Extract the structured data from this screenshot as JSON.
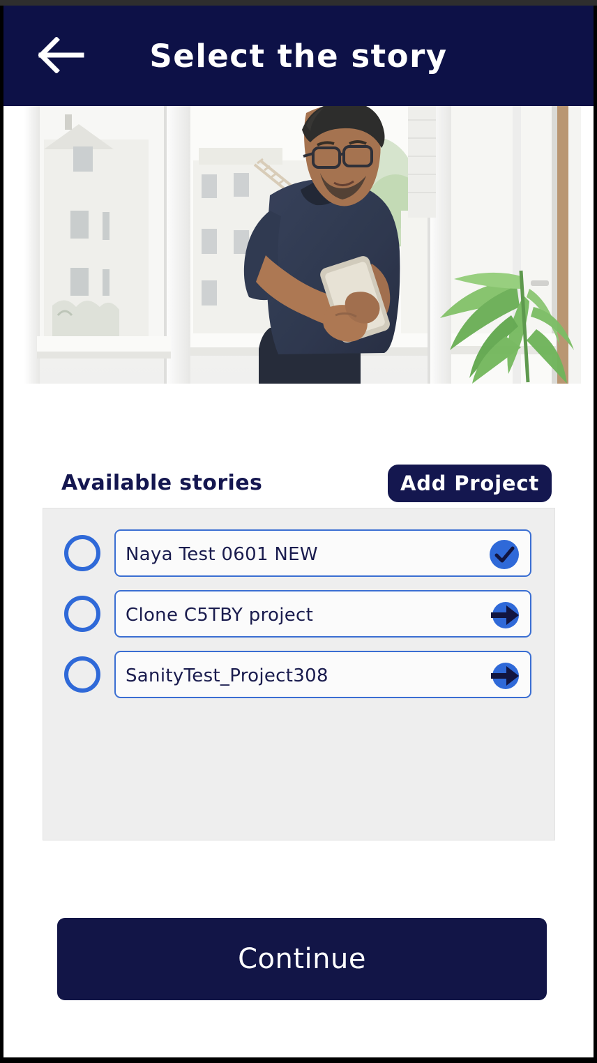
{
  "appbar": {
    "title": "Select the story",
    "back_icon": "arrow-left-icon",
    "background_color": "#0d1147"
  },
  "hero": {
    "alt": "Man in dark navy t-shirt standing by a bright window using a smartphone, potted palm on the right"
  },
  "section": {
    "heading": "Available stories",
    "add_project_label": "Add Project",
    "add_project_color": "#14174f"
  },
  "stories": [
    {
      "label": "Naya Test 0601 NEW",
      "selected": false,
      "action_icon": "check-circle-icon",
      "accent_color": "#2f69d8"
    },
    {
      "label": "Clone C5TBY project",
      "selected": false,
      "action_icon": "arrow-right-circle-icon",
      "accent_color": "#2f69d8"
    },
    {
      "label": "SanityTest_Project308",
      "selected": false,
      "action_icon": "arrow-right-circle-icon",
      "accent_color": "#2f69d8"
    }
  ],
  "footer": {
    "continue_label": "Continue",
    "continue_color": "#121547"
  }
}
